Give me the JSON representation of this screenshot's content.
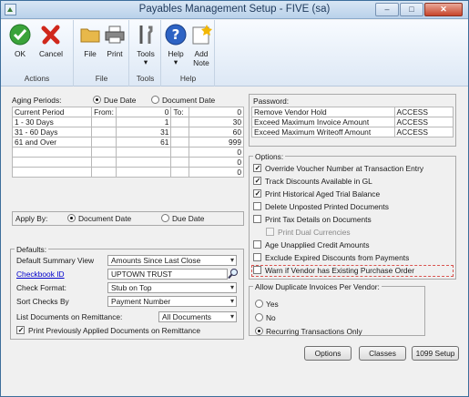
{
  "window": {
    "title": "Payables Management Setup  -  FIVE (sa)",
    "controls": {
      "minimize": "‒",
      "maximize": "□",
      "close": "✕"
    }
  },
  "ribbon": {
    "actions": {
      "ok": "OK",
      "cancel": "Cancel",
      "group": "Actions"
    },
    "file": {
      "file": "File",
      "print": "Print",
      "group": "File"
    },
    "tools": {
      "tools": "Tools",
      "group": "Tools"
    },
    "help": {
      "help": "Help",
      "add_note": "Add\nNote",
      "group": "Help"
    }
  },
  "aging": {
    "label": "Aging Periods:",
    "radio_due_date": "Due Date",
    "radio_document_date": "Document Date",
    "selected": "Due Date",
    "col_from": "From:",
    "col_to": "To:",
    "rows": [
      {
        "name": "Current Period",
        "from": "",
        "from_val": "0",
        "to": "0"
      },
      {
        "name": "1 - 30 Days",
        "from": "",
        "from_val": "1",
        "to": "30"
      },
      {
        "name": "31 - 60 Days",
        "from": "",
        "from_val": "31",
        "to": "60"
      },
      {
        "name": "61 and Over",
        "from": "",
        "from_val": "61",
        "to": "999"
      },
      {
        "name": "",
        "from": "",
        "from_val": "",
        "to": "0"
      },
      {
        "name": "",
        "from": "",
        "from_val": "",
        "to": "0"
      },
      {
        "name": "",
        "from": "",
        "from_val": "",
        "to": "0"
      }
    ]
  },
  "apply_by": {
    "label": "Apply By:",
    "document_date": "Document Date",
    "due_date": "Due Date",
    "selected": "Document Date"
  },
  "defaults": {
    "title": "Defaults:",
    "rows": [
      {
        "label": "Default Summary View",
        "value": "Amounts Since Last Close"
      },
      {
        "label": "Checkbook ID",
        "value": "UPTOWN TRUST"
      },
      {
        "label": "Check Format:",
        "value": "Stub on Top"
      },
      {
        "label": "Sort Checks By",
        "value": "Payment Number"
      }
    ],
    "list_docs_label": "List Documents on Remittance:",
    "list_docs_value": "All Documents",
    "print_applied_label": "Print Previously Applied Documents on Remittance"
  },
  "password": {
    "title": "Password:",
    "rows": [
      {
        "label": "Remove Vendor Hold",
        "value": "ACCESS"
      },
      {
        "label": "Exceed Maximum Invoice Amount",
        "value": "ACCESS"
      },
      {
        "label": "Exceed Maximum Writeoff Amount",
        "value": "ACCESS"
      }
    ]
  },
  "options": {
    "title": "Options:",
    "items": [
      {
        "label": "Override Voucher Number at Transaction Entry",
        "checked": true
      },
      {
        "label": "Track Discounts  Available in GL",
        "checked": true
      },
      {
        "label": "Print Historical  Aged Trial Balance",
        "checked": true
      },
      {
        "label": "Delete Unposted Printed Documents",
        "checked": false
      },
      {
        "label": "Print Tax Details on Documents",
        "checked": false
      },
      {
        "label": "Print Dual Currencies",
        "checked": false,
        "disabled": true
      },
      {
        "label": "Age Unapplied Credit Amounts",
        "checked": false
      },
      {
        "label": "Exclude Expired Discounts from Payments",
        "checked": false
      },
      {
        "label": "Warn if Vendor has Existing Purchase Order",
        "checked": false
      }
    ]
  },
  "duplicates": {
    "title": "Allow Duplicate Invoices Per Vendor:",
    "yes": "Yes",
    "no": "No",
    "recurring": "Recurring Transactions Only",
    "selected": "Recurring Transactions Only"
  },
  "buttons": {
    "options": "Options",
    "classes": "Classes",
    "setup_1099": "1099 Setup"
  },
  "colors": {
    "accent": "#1e395b",
    "link": "#0000cc",
    "highlight_border": "#d9534f"
  }
}
